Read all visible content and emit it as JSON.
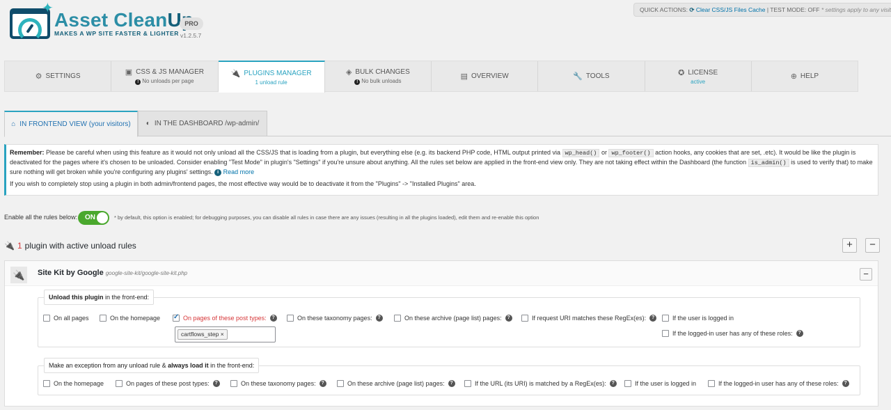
{
  "brand": {
    "title_a": "Asset Clean",
    "title_b": "Up",
    "subtitle": "MAKES A WP SITE FASTER & LIGHTER",
    "badge": "PRO",
    "version": "v1.2.5.7"
  },
  "quick_actions": {
    "prefix": "QUICK ACTIONS:",
    "clear_cache": "Clear CSS/JS Files Cache",
    "test_mode": "| TEST MODE: OFF",
    "hint": "* settings apply to any visitor"
  },
  "tabs": [
    {
      "label": "SETTINGS",
      "sub": "",
      "icon": "gear-icon"
    },
    {
      "label": "CSS & JS MANAGER",
      "sub": "No unloads per page",
      "icon": "file-icon"
    },
    {
      "label": "PLUGINS MANAGER",
      "sub": "1 unload rule",
      "icon": "plug-icon"
    },
    {
      "label": "BULK CHANGES",
      "sub": "No bulk unloads",
      "icon": "layers-icon"
    },
    {
      "label": "OVERVIEW",
      "sub": "",
      "icon": "document-icon"
    },
    {
      "label": "TOOLS",
      "sub": "",
      "icon": "wrench-icon"
    },
    {
      "label": "LICENSE",
      "sub": "active",
      "icon": "award-icon"
    },
    {
      "label": "HELP",
      "sub": "",
      "icon": "lifebuoy-icon"
    }
  ],
  "subtabs": {
    "frontend": "IN FRONTEND VIEW (your visitors)",
    "dashboard": "IN THE DASHBOARD /wp-admin/"
  },
  "notice": {
    "remember": "Remember:",
    "p1a": "Please be careful when using this feature as it would not only unload all the CSS/JS that is loading from a plugin, but everything else (e.g. its backend PHP code, HTML output printed via",
    "code1": "wp_head()",
    "or": "or",
    "code2": "wp_footer()",
    "p1b": "action hooks, any cookies that are set, .etc). It would be like the plugin is deactivated for the pages where it's chosen to be unloaded. Consider enabling \"Test Mode\" in plugin's \"Settings\" if you're unsure about anything. All the rules set below are applied in the front-end view only. They are not taking effect within the Dashboard (the function",
    "code3": "is_admin()",
    "p1c": "is used to verify that) to make sure nothing will get broken while you're configuring any plugins' settings.",
    "read_more": "Read more",
    "p2": "If you wish to completely stop using a plugin in both admin/frontend pages, the most effective way would be to deactivate it from the \"Plugins\" -> \"Installed Plugins\" area."
  },
  "enable_rules": {
    "label": "Enable all the rules below:",
    "toggle": "ON",
    "hint": "* by default, this option is enabled; for debugging purposes, you can disable all rules in case there are any issues (resulting in all the plugins loaded), edit them and re-enable this option"
  },
  "heading": {
    "count": "1",
    "text": "plugin with active unload rules",
    "plus": "+",
    "minus": "−"
  },
  "plugin": {
    "name": "Site Kit by Google",
    "path": "google-site-kit/google-site-kit.php",
    "collapse": "−",
    "unload_legend_bold": "Unload this plugin",
    "unload_legend_rest": "in the front-end:",
    "unload_options": [
      {
        "label": "On all pages",
        "checked": false,
        "help": false
      },
      {
        "label": "On the homepage",
        "checked": false,
        "help": false
      },
      {
        "label": "On pages of these post types:",
        "checked": true,
        "help": true
      },
      {
        "label": "On these taxonomy pages:",
        "checked": false,
        "help": true
      },
      {
        "label": "On these archive (page list) pages:",
        "checked": false,
        "help": true
      },
      {
        "label": "If request URI matches these RegEx(es):",
        "checked": false,
        "help": true
      },
      {
        "label": "If the user is logged in",
        "checked": false,
        "help": false
      },
      {
        "label": "If the logged-in user has any of these roles:",
        "checked": false,
        "help": true
      }
    ],
    "post_type_tag": "cartflows_step",
    "tag_remove": "×",
    "exception_legend_a": "Make an exception from any unload rule &",
    "exception_legend_bold": "always load it",
    "exception_legend_b": "in the front-end:",
    "exception_options": [
      {
        "label": "On the homepage",
        "help": false
      },
      {
        "label": "On pages of these post types:",
        "help": true
      },
      {
        "label": "On these taxonomy pages:",
        "help": true
      },
      {
        "label": "On these archive (page list) pages:",
        "help": true
      },
      {
        "label": "If the URL (its URI) is matched by a RegEx(es):",
        "help": true
      },
      {
        "label": "If the user is logged in",
        "help": false
      },
      {
        "label": "If the logged-in user has any of these roles:",
        "help": true
      }
    ]
  }
}
